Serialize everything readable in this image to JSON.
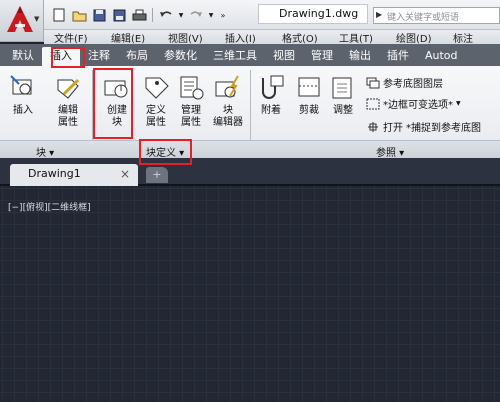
{
  "app": {
    "doc_title": "Drawing1.dwg",
    "search_placeholder": "键入关键字或短语",
    "logo": "autocad-logo"
  },
  "quick_access": [
    "new-icon",
    "open-icon",
    "save-icon",
    "saveas-icon",
    "print-icon",
    "undo-icon",
    "redo-icon"
  ],
  "menu": [
    "文件(F)",
    "编辑(E)",
    "视图(V)",
    "插入(I)",
    "格式(O)",
    "工具(T)",
    "绘图(D)",
    "标注"
  ],
  "ribbon_tabs": [
    "默认",
    "插入",
    "注释",
    "布局",
    "参数化",
    "三维工具",
    "视图",
    "管理",
    "输出",
    "插件",
    "Autod"
  ],
  "active_tab": "插入",
  "ribbon": {
    "insert": "插入",
    "edit_attr": "编辑\n属性",
    "create_block": "创建\n块",
    "define_attr": "定义\n属性",
    "manage_attr": "管理\n属性",
    "block_editor": "块\n编辑器",
    "attach": "附着",
    "clip": "剪裁",
    "adjust": "调整",
    "underlay_layers": "参考底图图层",
    "frame_option": "*边框可变选项*",
    "snap_label": "打开",
    "snap_option": "*捕捉到参考底图",
    "panel_block": "块",
    "panel_block_def": "块定义",
    "panel_reference": "参照"
  },
  "doc_tab": {
    "name": "Drawing1",
    "close": "×"
  },
  "viewport_label": "[−][俯视][二维线框]",
  "colors": {
    "highlight": "#e3212a",
    "canvas": "#222733",
    "tabbar": "#5d636d"
  }
}
